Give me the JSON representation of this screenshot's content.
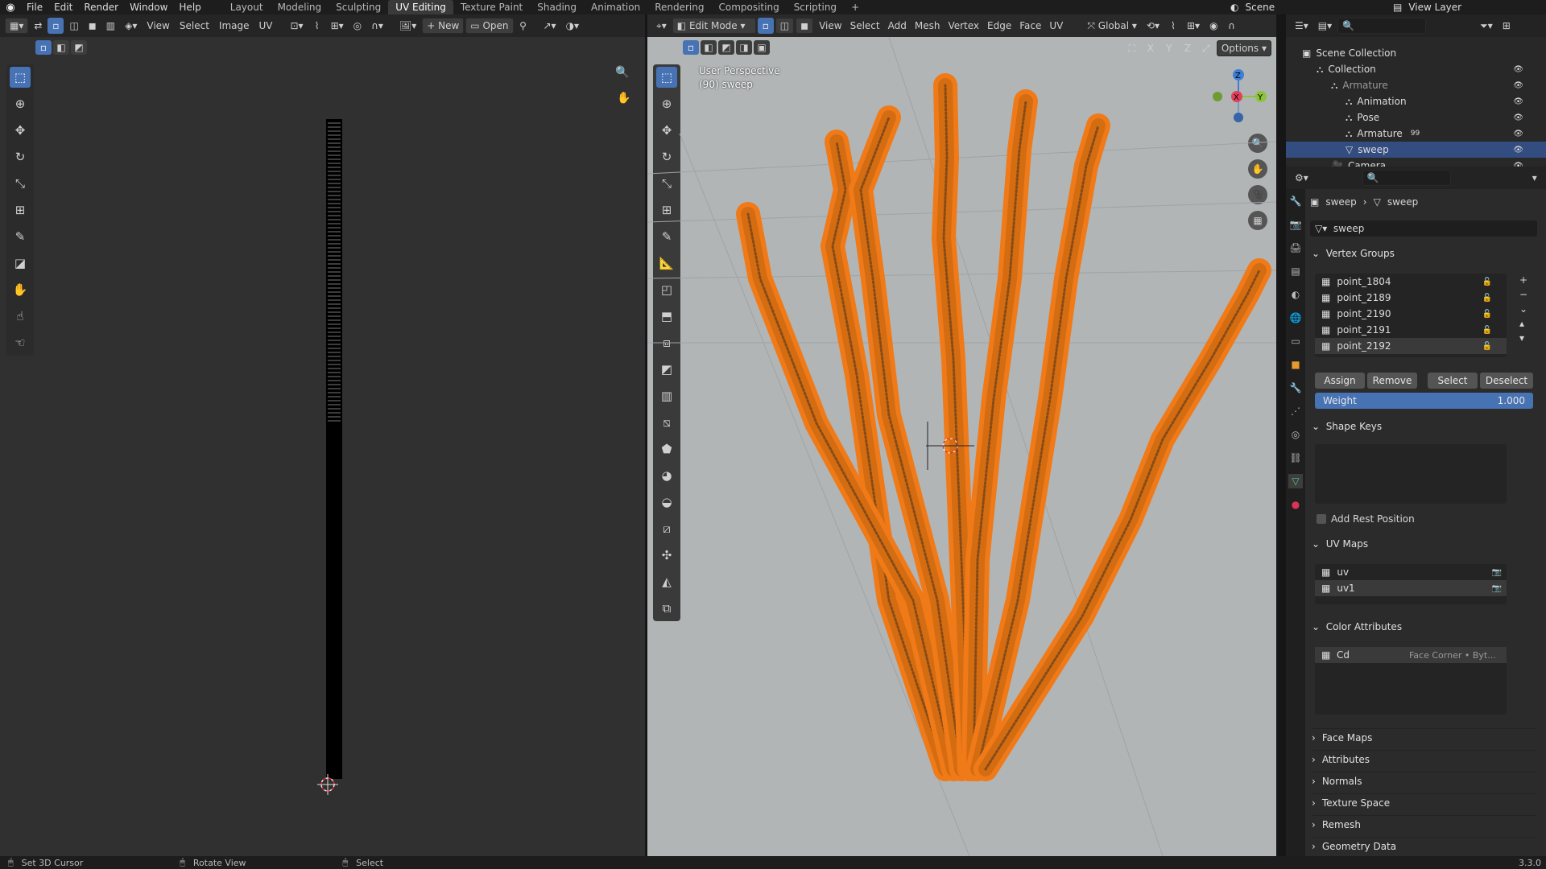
{
  "app": {
    "menus": [
      "File",
      "Edit",
      "Render",
      "Window",
      "Help"
    ],
    "workspaces": [
      "Layout",
      "Modeling",
      "Sculpting",
      "UV Editing",
      "Texture Paint",
      "Shading",
      "Animation",
      "Rendering",
      "Compositing",
      "Scripting",
      "+"
    ],
    "active_workspace": "UV Editing",
    "scene": "Scene",
    "view_layer": "View Layer",
    "version": "3.3.0"
  },
  "uv_editor": {
    "menus": [
      "View",
      "Select",
      "Image",
      "UV"
    ],
    "new_label": "New",
    "open_label": "Open"
  },
  "viewport": {
    "mode": "Edit Mode",
    "menus": [
      "View",
      "Select",
      "Add",
      "Mesh",
      "Vertex",
      "Edge",
      "Face",
      "UV"
    ],
    "orientation": "Global",
    "options_label": "Options",
    "overlay_line1": "User Perspective",
    "overlay_line2": "(90) sweep",
    "axes": [
      "X",
      "Y",
      "Z"
    ]
  },
  "outliner": {
    "rows": [
      {
        "label": "Scene Collection",
        "indent": 0
      },
      {
        "label": "Collection",
        "indent": 1
      },
      {
        "label": "Armature",
        "indent": 2,
        "dim": true
      },
      {
        "label": "Animation",
        "indent": 3
      },
      {
        "label": "Pose",
        "indent": 3
      },
      {
        "label": "Armature",
        "indent": 3,
        "badge": "99"
      },
      {
        "label": "sweep",
        "indent": 3,
        "highlight": true
      },
      {
        "label": "Camera",
        "indent": 2
      }
    ]
  },
  "properties": {
    "breadcrumb_obj": "sweep",
    "breadcrumb_data": "sweep",
    "mesh_name": "sweep",
    "vertex_groups": {
      "title": "Vertex Groups",
      "items": [
        "point_1804",
        "point_2189",
        "point_2190",
        "point_2191",
        "point_2192"
      ],
      "selected": 4,
      "assign": "Assign",
      "remove": "Remove",
      "select": "Select",
      "deselect": "Deselect",
      "weight_label": "Weight",
      "weight_value": "1.000"
    },
    "shape_keys": {
      "title": "Shape Keys",
      "add_rest": "Add Rest Position"
    },
    "uv_maps": {
      "title": "UV Maps",
      "items": [
        "uv",
        "uv1"
      ]
    },
    "color_attributes": {
      "title": "Color Attributes",
      "name": "Cd",
      "domain": "Face Corner • Byt..."
    },
    "collapsed_panels": [
      "Face Maps",
      "Attributes",
      "Normals",
      "Texture Space",
      "Remesh",
      "Geometry Data"
    ]
  },
  "statusbar": {
    "items": [
      "Set 3D Cursor",
      "Rotate View",
      "Select"
    ]
  },
  "colors": {
    "accent": "#4772b3",
    "mesh": "#f07a18",
    "viewport_bg": "#b2b5b6"
  }
}
